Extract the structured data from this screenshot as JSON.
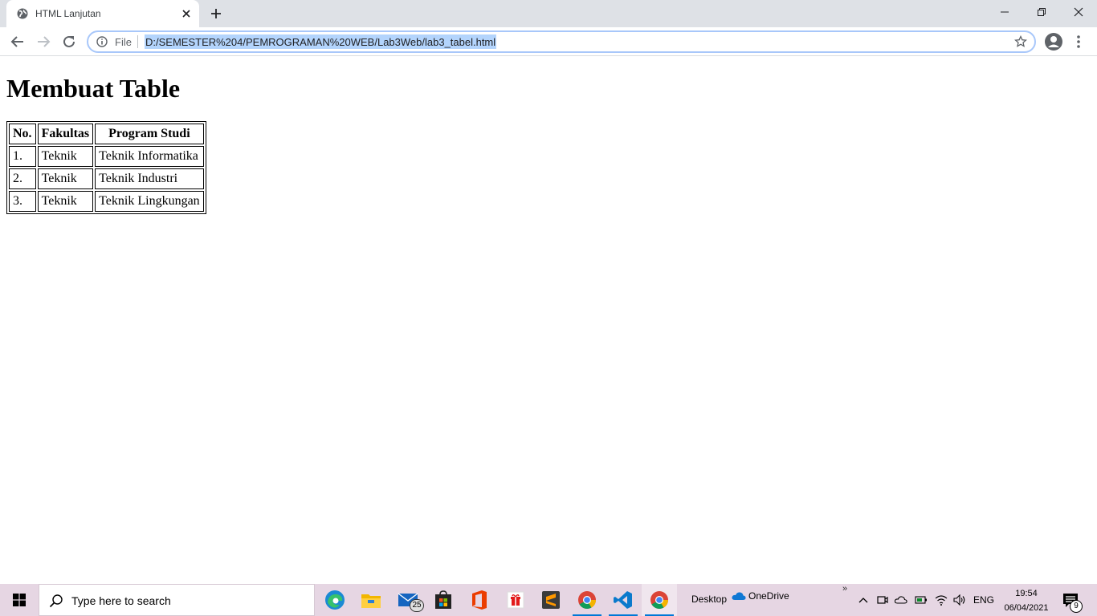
{
  "browser": {
    "tab": {
      "title": "HTML Lanjutan",
      "favicon": "globe-icon"
    },
    "omnibox": {
      "scheme_label": "File",
      "url": "D:/SEMESTER%204/PEMROGRAMAN%20WEB/Lab3Web/lab3_tabel.html"
    }
  },
  "page": {
    "heading": "Membuat Table",
    "table": {
      "headers": [
        "No.",
        "Fakultas",
        "Program Studi"
      ],
      "rows": [
        [
          "1.",
          "Teknik",
          "Teknik Informatika"
        ],
        [
          "2.",
          "Teknik",
          "Teknik Industri"
        ],
        [
          "3.",
          "Teknik",
          "Teknik Lingkungan"
        ]
      ]
    }
  },
  "taskbar": {
    "search_placeholder": "Type here to search",
    "apps": [
      {
        "name": "edge-icon"
      },
      {
        "name": "file-explorer-icon"
      },
      {
        "name": "mail-icon",
        "badge": "25"
      },
      {
        "name": "store-icon"
      },
      {
        "name": "office-icon"
      },
      {
        "name": "gift-icon"
      },
      {
        "name": "sublime-text-icon"
      },
      {
        "name": "chrome-icon"
      },
      {
        "name": "vscode-icon"
      },
      {
        "name": "chrome-icon"
      }
    ],
    "desktop_label": "Desktop",
    "onedrive_label": "OneDrive",
    "language": "ENG",
    "time": "19:54",
    "date": "06/04/2021",
    "notification_count": "9"
  },
  "colors": {
    "tabstrip_bg": "#dee1e6",
    "url_selection": "#b3d4fc",
    "taskbar_bg": "#e6d6e3",
    "taskbar_accent": "#0078d7"
  }
}
